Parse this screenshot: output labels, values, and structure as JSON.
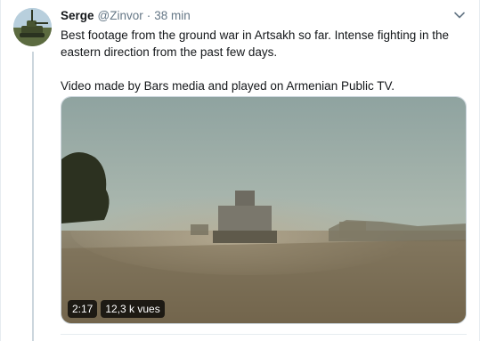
{
  "tweet": {
    "display_name": "Serge",
    "handle": "@Zinvor",
    "separator": "·",
    "time": "38 min",
    "text_line1": "Best footage from the ground war in Artsakh so far. Intense fighting in the eastern direction from the past few days.",
    "text_line2": "Video made by Bars media and played on Armenian Public TV."
  },
  "video": {
    "duration": "2:17",
    "views": "12,3 k vues"
  },
  "icons": {
    "caret": "chevron-down-icon"
  },
  "colors": {
    "text": "#14171a",
    "muted": "#657786",
    "border": "#e6ecf0"
  }
}
